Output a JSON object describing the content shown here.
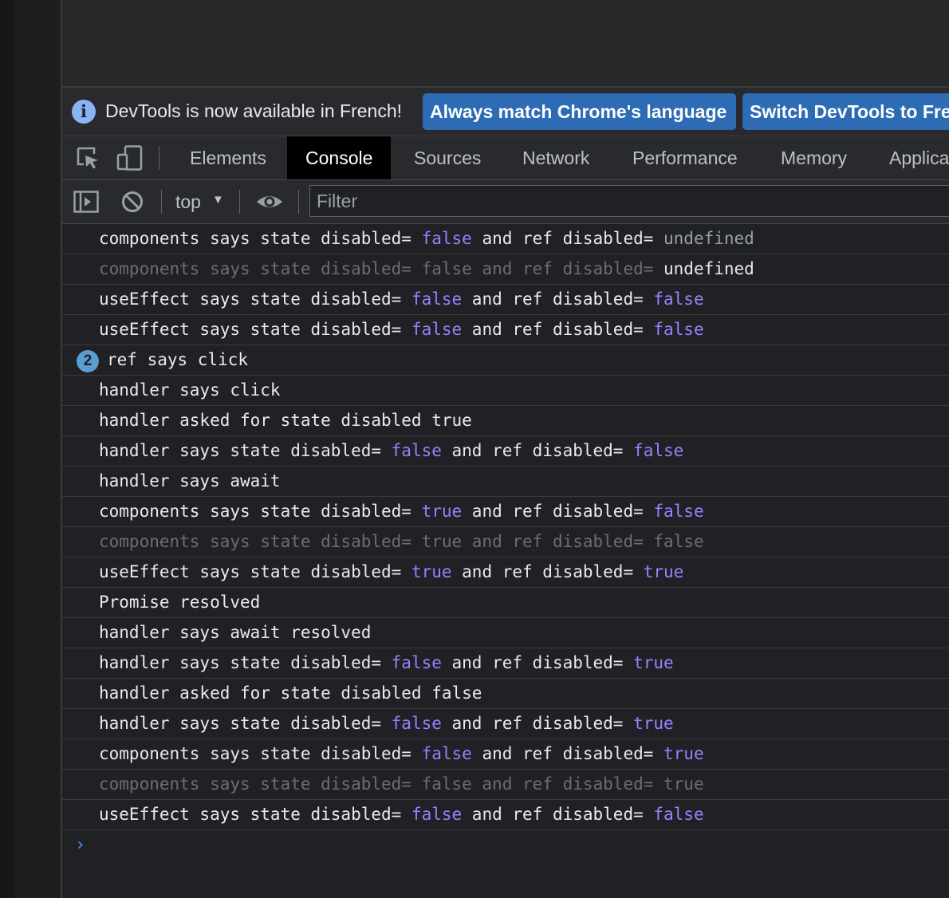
{
  "infobar": {
    "message": "DevTools is now available in French!",
    "match_language_label": "Always match Chrome's language",
    "switch_language_label": "Switch DevTools to French"
  },
  "tabs": [
    {
      "label": "Elements",
      "active": false
    },
    {
      "label": "Console",
      "active": true
    },
    {
      "label": "Sources",
      "active": false
    },
    {
      "label": "Network",
      "active": false
    },
    {
      "label": "Performance",
      "active": false
    },
    {
      "label": "Memory",
      "active": false
    },
    {
      "label": "Application",
      "active": false
    }
  ],
  "toolbar": {
    "context": "top",
    "filter_placeholder": "Filter"
  },
  "colors": {
    "boolean": "#9980ff",
    "undefined": "#9aa0a6",
    "repeat_badge": "#5c9ccf",
    "info_button": "#2e6bb5"
  },
  "console": {
    "prompt_icon": "chevron-right-icon",
    "rows": [
      {
        "dim": false,
        "parts": [
          {
            "t": "components says state disabled= "
          },
          {
            "t": "false",
            "k": "bool"
          },
          {
            "t": " and ref disabled= "
          },
          {
            "t": "undefined",
            "k": "undef"
          }
        ]
      },
      {
        "dim": true,
        "parts": [
          {
            "t": "components says state disabled= false and ref disabled= "
          },
          {
            "t": "undefined",
            "k": "str"
          }
        ]
      },
      {
        "dim": false,
        "parts": [
          {
            "t": "useEffect says state disabled= "
          },
          {
            "t": "false",
            "k": "bool"
          },
          {
            "t": " and ref disabled= "
          },
          {
            "t": "false",
            "k": "bool"
          }
        ]
      },
      {
        "dim": false,
        "parts": [
          {
            "t": "useEffect says state disabled= "
          },
          {
            "t": "false",
            "k": "bool"
          },
          {
            "t": " and ref disabled= "
          },
          {
            "t": "false",
            "k": "bool"
          }
        ]
      },
      {
        "dim": false,
        "badge": "2",
        "parts": [
          {
            "t": "ref says click"
          }
        ]
      },
      {
        "dim": false,
        "parts": [
          {
            "t": "handler says click"
          }
        ]
      },
      {
        "dim": false,
        "parts": [
          {
            "t": "handler asked for state disabled true"
          }
        ]
      },
      {
        "dim": false,
        "parts": [
          {
            "t": "handler says state disabled= "
          },
          {
            "t": "false",
            "k": "bool"
          },
          {
            "t": " and ref disabled= "
          },
          {
            "t": "false",
            "k": "bool"
          }
        ]
      },
      {
        "dim": false,
        "parts": [
          {
            "t": "handler says await"
          }
        ]
      },
      {
        "dim": false,
        "parts": [
          {
            "t": "components says state disabled= "
          },
          {
            "t": "true",
            "k": "bool"
          },
          {
            "t": " and ref disabled= "
          },
          {
            "t": "false",
            "k": "bool"
          }
        ]
      },
      {
        "dim": true,
        "parts": [
          {
            "t": "components says state disabled= true and ref disabled= false"
          }
        ]
      },
      {
        "dim": false,
        "parts": [
          {
            "t": "useEffect says state disabled= "
          },
          {
            "t": "true",
            "k": "bool"
          },
          {
            "t": " and ref disabled= "
          },
          {
            "t": "true",
            "k": "bool"
          }
        ]
      },
      {
        "dim": false,
        "parts": [
          {
            "t": "Promise resolved"
          }
        ]
      },
      {
        "dim": false,
        "parts": [
          {
            "t": "handler says await resolved"
          }
        ]
      },
      {
        "dim": false,
        "parts": [
          {
            "t": "handler says state disabled= "
          },
          {
            "t": "false",
            "k": "bool"
          },
          {
            "t": " and ref disabled= "
          },
          {
            "t": "true",
            "k": "bool"
          }
        ]
      },
      {
        "dim": false,
        "parts": [
          {
            "t": "handler asked for state disabled false"
          }
        ]
      },
      {
        "dim": false,
        "parts": [
          {
            "t": "handler says state disabled= "
          },
          {
            "t": "false",
            "k": "bool"
          },
          {
            "t": " and ref disabled= "
          },
          {
            "t": "true",
            "k": "bool"
          }
        ]
      },
      {
        "dim": false,
        "parts": [
          {
            "t": "components says state disabled= "
          },
          {
            "t": "false",
            "k": "bool"
          },
          {
            "t": " and ref disabled= "
          },
          {
            "t": "true",
            "k": "bool"
          }
        ]
      },
      {
        "dim": true,
        "parts": [
          {
            "t": "components says state disabled= false and ref disabled= true"
          }
        ]
      },
      {
        "dim": false,
        "parts": [
          {
            "t": "useEffect says state disabled= "
          },
          {
            "t": "false",
            "k": "bool"
          },
          {
            "t": " and ref disabled= "
          },
          {
            "t": "false",
            "k": "bool"
          }
        ]
      }
    ]
  }
}
